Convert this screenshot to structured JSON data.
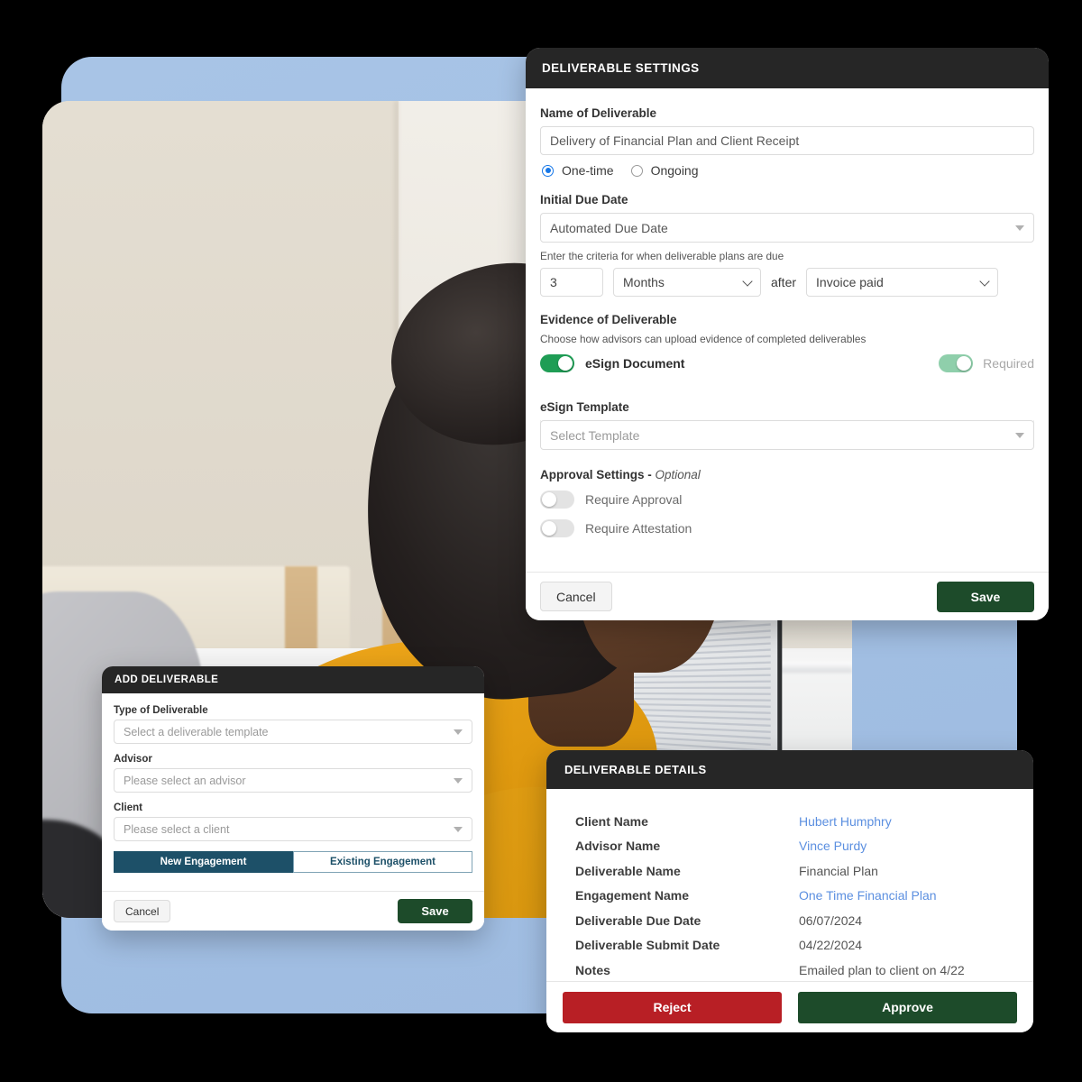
{
  "settings_panel": {
    "title": "DELIVERABLE SETTINGS",
    "name_label": "Name of Deliverable",
    "name_value": "Delivery of Financial Plan and Client Receipt",
    "frequency": {
      "options": [
        "One-time",
        "Ongoing"
      ],
      "selected": "One-time"
    },
    "due_date_label": "Initial Due Date",
    "due_date_value": "Automated Due Date",
    "criteria_note": "Enter the criteria for when deliverable plans are due",
    "criteria": {
      "amount": "3",
      "unit": "Months",
      "conjunction": "after",
      "event": "Invoice paid"
    },
    "evidence_label": "Evidence of Deliverable",
    "evidence_note": "Choose how advisors can upload evidence of completed deliverables",
    "evidence_toggle_label": "eSign Document",
    "evidence_toggle_state": "on",
    "required_toggle_label": "Required",
    "required_toggle_state": "on",
    "template_label": "eSign Template",
    "template_placeholder": "Select Template",
    "approval_label": "Approval Settings",
    "approval_optional": "Optional",
    "approval_toggles": [
      {
        "label": "Require Approval",
        "state": "off"
      },
      {
        "label": "Require Attestation",
        "state": "off"
      }
    ],
    "cancel_label": "Cancel",
    "save_label": "Save"
  },
  "add_deliverable_panel": {
    "title": "ADD DELIVERABLE",
    "fields": [
      {
        "label": "Type of Deliverable",
        "placeholder": "Select a deliverable template"
      },
      {
        "label": "Advisor",
        "placeholder": "Please select an advisor"
      },
      {
        "label": "Client",
        "placeholder": "Please select a client"
      }
    ],
    "segments": [
      {
        "label": "New Engagement",
        "active": true
      },
      {
        "label": "Existing Engagement",
        "active": false
      }
    ],
    "cancel_label": "Cancel",
    "save_label": "Save"
  },
  "details_panel": {
    "title": "DELIVERABLE DETAILS",
    "rows": [
      {
        "key": "Client Name",
        "value": "Hubert Humphry",
        "link": true
      },
      {
        "key": "Advisor Name",
        "value": "Vince Purdy",
        "link": true
      },
      {
        "key": "Deliverable Name",
        "value": "Financial Plan",
        "link": false
      },
      {
        "key": "Engagement Name",
        "value": "One Time Financial Plan",
        "link": true
      },
      {
        "key": "Deliverable Due Date",
        "value": "06/07/2024",
        "link": false
      },
      {
        "key": "Deliverable Submit Date",
        "value": "04/22/2024",
        "link": false
      },
      {
        "key": "Notes",
        "value": "Emailed plan to client on 4/22",
        "link": false
      }
    ],
    "reject_label": "Reject",
    "approve_label": "Approve"
  },
  "colors": {
    "background": "#000000",
    "card_blue": "#a6c2e4",
    "header_dark": "#262626",
    "green_primary": "#1d4b2a",
    "green_toggle": "#1f9d55",
    "green_toggle_muted": "#8fcfab",
    "red_reject": "#b81f25",
    "teal_segment": "#1d5068",
    "link_blue": "#5b8fe0",
    "radio_blue": "#1677e8"
  }
}
